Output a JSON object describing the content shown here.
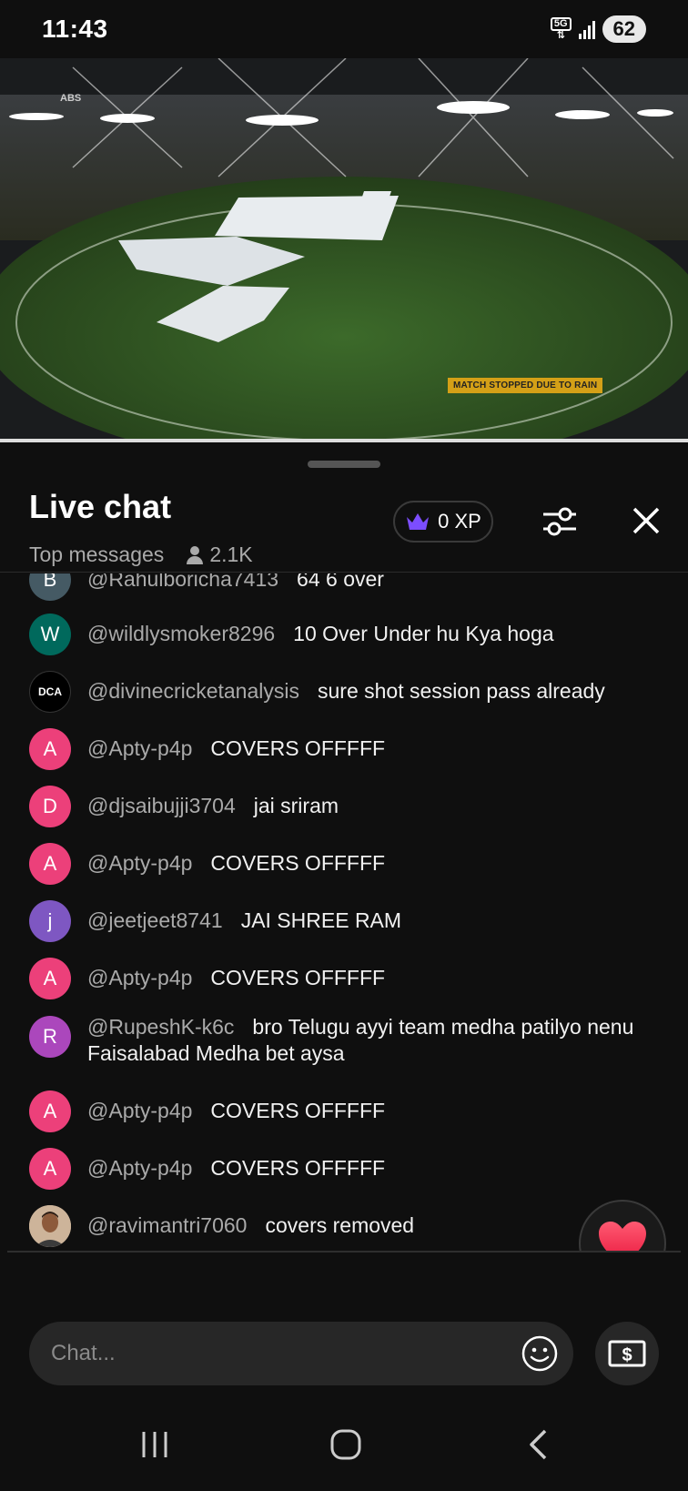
{
  "status_bar": {
    "time": "11:43",
    "network": "5G",
    "battery": "62"
  },
  "video": {
    "caption": "MATCH STOPPED DUE TO RAIN",
    "logo_text": "ABS"
  },
  "chat": {
    "title": "Live chat",
    "mode": "Top messages",
    "viewers": "2.1K",
    "xp_label": "0 XP"
  },
  "messages": [
    {
      "initial": "B",
      "avatar_color": "#455a64",
      "author": "@Rahulboricha7413",
      "text": "64 6 over"
    },
    {
      "initial": "W",
      "avatar_color": "#00695c",
      "author": "@wildlysmoker8296",
      "text": "10 Over Under hu Kya hoga"
    },
    {
      "initial": "DCA",
      "avatar_color": "#000000",
      "author": "@divinecricketanalysis",
      "text": "sure shot session pass already"
    },
    {
      "initial": "A",
      "avatar_color": "#ec407a",
      "author": "@Apty-p4p",
      "text": "COVERS OFFFFF"
    },
    {
      "initial": "D",
      "avatar_color": "#ec407a",
      "author": "@djsaibujji3704",
      "text": "jai sriram"
    },
    {
      "initial": "A",
      "avatar_color": "#ec407a",
      "author": "@Apty-p4p",
      "text": "COVERS OFFFFF"
    },
    {
      "initial": "j",
      "avatar_color": "#7e57c2",
      "author": "@jeetjeet8741",
      "text": "JAI SHREE RAM"
    },
    {
      "initial": "A",
      "avatar_color": "#ec407a",
      "author": "@Apty-p4p",
      "text": "COVERS OFFFFF"
    },
    {
      "initial": "R",
      "avatar_color": "#ab47bc",
      "author": "@RupeshK-k6c",
      "text": "bro Telugu ayyi team medha patilyo nenu Faisalabad Medha bet aysa"
    },
    {
      "initial": "A",
      "avatar_color": "#ec407a",
      "author": "@Apty-p4p",
      "text": "COVERS OFFFFF"
    },
    {
      "initial": "A",
      "avatar_color": "#ec407a",
      "author": "@Apty-p4p",
      "text": "COVERS OFFFFF"
    },
    {
      "initial": "",
      "avatar_color": "#8d6e63",
      "author": "@ravimantri7060",
      "text": "covers removed"
    }
  ],
  "input": {
    "placeholder": "Chat..."
  }
}
